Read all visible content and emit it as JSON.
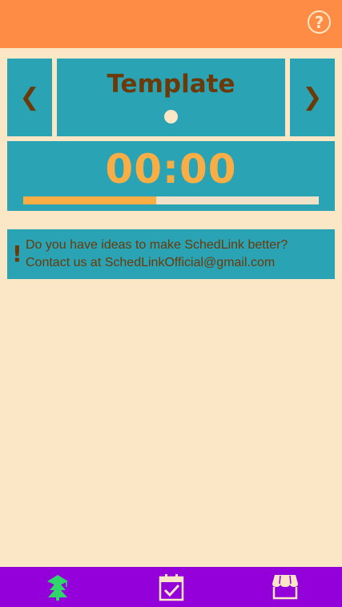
{
  "header": {
    "help_label": "?"
  },
  "carousel": {
    "prev_label": "❮",
    "next_label": "❯",
    "title": "Template"
  },
  "timer": {
    "value": "00:00",
    "progress_fraction": 0.45
  },
  "info": {
    "marker": "!",
    "line1": "Do you have ideas to make SchedLink better?",
    "line2": "Contact us at SchedLinkOfficial@gmail.com"
  },
  "nav": {
    "items": [
      {
        "icon": "graduation-tree-icon",
        "color": "#2fd66a"
      },
      {
        "icon": "calendar-check-icon",
        "color": "#fbe7c6"
      },
      {
        "icon": "shop-icon",
        "color": "#fbe7c6"
      }
    ]
  },
  "colors": {
    "header": "#ff8c45",
    "background": "#fbe7c6",
    "panel": "#2aa3b4",
    "accent": "#f9ad45",
    "text_brown": "#6b3a08",
    "nav_bg": "#9400d9"
  }
}
